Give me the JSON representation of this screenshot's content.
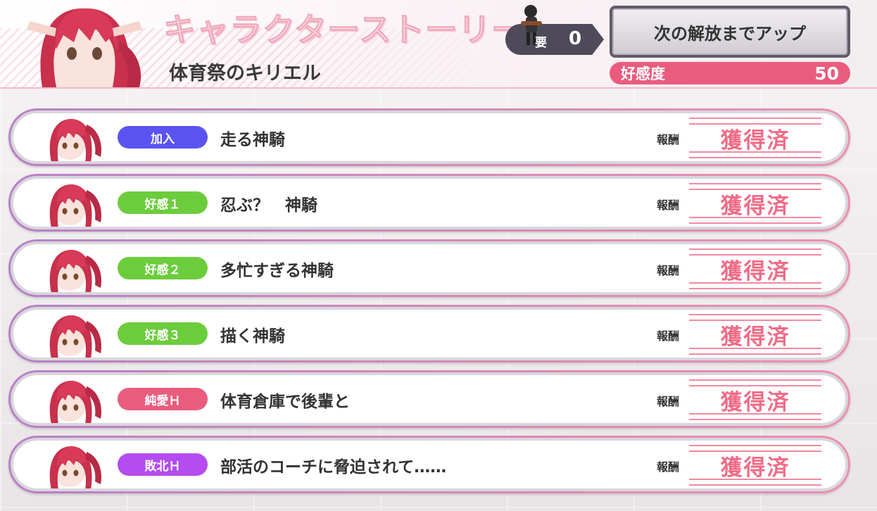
{
  "header": {
    "title": "キャラクターストーリー",
    "subtitle": "体育祭のキリエル",
    "key_label": "要",
    "key_count": "0",
    "unlock_button": "次の解放までアップ",
    "affinity_label": "好感度",
    "affinity_value": "50"
  },
  "colors": {
    "join": "#5a53f0",
    "affection": "#6ccd3c",
    "pure_love": "#ea5c7e",
    "defeat": "#b44cef",
    "accent_pink": "#ea5c7e"
  },
  "stories": [
    {
      "badge": "加入",
      "badge_type": "join",
      "title": "走る神騎",
      "reward_label": "報酬",
      "status": "獲得済"
    },
    {
      "badge": "好感１",
      "badge_type": "affection",
      "title": "忍ぶ？　神騎",
      "reward_label": "報酬",
      "status": "獲得済"
    },
    {
      "badge": "好感２",
      "badge_type": "affection",
      "title": "多忙すぎる神騎",
      "reward_label": "報酬",
      "status": "獲得済"
    },
    {
      "badge": "好感３",
      "badge_type": "affection",
      "title": "描く神騎",
      "reward_label": "報酬",
      "status": "獲得済"
    },
    {
      "badge": "純愛Ｈ",
      "badge_type": "pure_love",
      "title": "体育倉庫で後輩と",
      "reward_label": "報酬",
      "status": "獲得済"
    },
    {
      "badge": "敗北Ｈ",
      "badge_type": "defeat",
      "title": "部活のコーチに脅迫されて……",
      "reward_label": "報酬",
      "status": "獲得済"
    }
  ]
}
